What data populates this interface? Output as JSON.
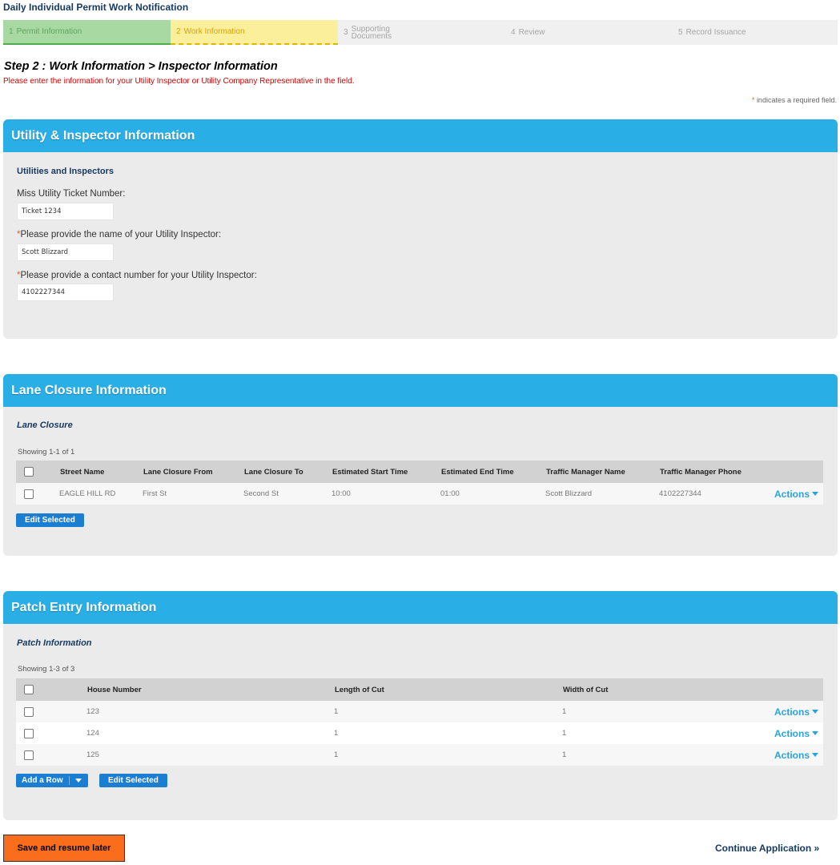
{
  "app_title": "Daily Individual Permit Work Notification",
  "steps": [
    {
      "num": "1",
      "label": "Permit Information"
    },
    {
      "num": "2",
      "label": "Work Information"
    },
    {
      "num": "3",
      "label_line1": "Supporting",
      "label_line2": "Documents"
    },
    {
      "num": "4",
      "label": "Review"
    },
    {
      "num": "5",
      "label": "Record Issuance"
    }
  ],
  "step_heading": "Step 2 : Work Information > Inspector Information",
  "step_subtext": "Please enter the information for your Utility Inspector or Utility Company Representative in the field.",
  "required_note": {
    "star": "*",
    "text": "indicates a required field."
  },
  "utility_panel": {
    "title": "Utility & Inspector Information",
    "section_title": "Utilities and Inspectors",
    "fields": [
      {
        "required": false,
        "label": "Miss Utility Ticket Number:",
        "value": "Ticket 1234"
      },
      {
        "required": true,
        "label": "Please provide the name of your Utility Inspector:",
        "value": "Scott Blizzard"
      },
      {
        "required": true,
        "label": "Please provide a contact number for your Utility Inspector:",
        "value": "4102227344"
      }
    ]
  },
  "lane_panel": {
    "title": "Lane Closure Information",
    "section_title": "Lane Closure",
    "showing": "Showing 1-1 of 1",
    "columns": [
      "Street Name",
      "Lane Closure From",
      "Lane Closure To",
      "Estimated Start Time",
      "Estimated End Time",
      "Traffic Manager Name",
      "Traffic Manager Phone"
    ],
    "rows": [
      {
        "street": "EAGLE HILL RD",
        "from": "First St",
        "to": "Second St",
        "start": "10:00",
        "end": "01:00",
        "tm_name": "Scott Blizzard",
        "tm_phone": "4102227344",
        "actions": "Actions"
      }
    ],
    "edit_selected": "Edit Selected"
  },
  "patch_panel": {
    "title": "Patch Entry Information",
    "section_title": "Patch Information",
    "showing": "Showing 1-3 of 3",
    "columns": [
      "House Number",
      "Length of Cut",
      "Width of Cut"
    ],
    "rows": [
      {
        "house": "123",
        "length": "1",
        "width": "1",
        "actions": "Actions"
      },
      {
        "house": "124",
        "length": "1",
        "width": "1",
        "actions": "Actions"
      },
      {
        "house": "125",
        "length": "1",
        "width": "1",
        "actions": "Actions"
      }
    ],
    "add_row": "Add a Row",
    "edit_selected": "Edit Selected"
  },
  "footer": {
    "save_label": "Save and resume later",
    "continue_label": "Continue Application »"
  },
  "colors": {
    "panel_header": "#29aee6",
    "button_blue": "#1b7ed1",
    "save_orange": "#fa6d1d",
    "required_red": "#d30000"
  }
}
